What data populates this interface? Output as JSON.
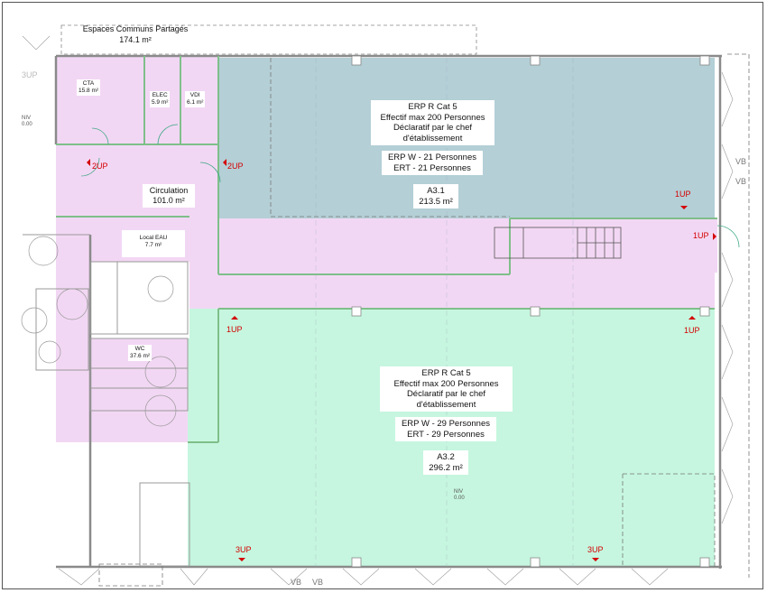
{
  "shared_space": {
    "name": "Espaces Communs Partagés",
    "area": "174.1 m²"
  },
  "rooms": {
    "cta": {
      "name": "CTA",
      "area": "15.8 m²"
    },
    "elec": {
      "name": "ELEC",
      "area": "5.9 m²"
    },
    "vdi": {
      "name": "VDI",
      "area": "6.1 m²"
    },
    "circulation": {
      "name": "Circulation",
      "area": "101.0 m²"
    },
    "local_eau": {
      "name": "Local EAU",
      "area": "7.7 m²"
    },
    "wc": {
      "name": "WC",
      "area": "37.6 m²"
    }
  },
  "a31": {
    "line1": "ERP R Cat 5",
    "line2": "Effectif max  200 Personnes",
    "line3": "Déclaratif par le chef",
    "line4": "d'établissement",
    "erp_w": "ERP W - 21 Personnes",
    "ert": "ERT - 21 Personnes",
    "id": "A3.1",
    "area": "213.5 m²"
  },
  "a32": {
    "line1": "ERP R Cat 5",
    "line2": "Effectif max  200 Personnes",
    "line3": "Déclaratif par le chef",
    "line4": "d'établissement",
    "erp_w": "ERP W - 29 Personnes",
    "ert": "ERT - 29 Personnes",
    "id": "A3.2",
    "area": "296.2 m²"
  },
  "markers": {
    "up3_top": "3UP",
    "up2_left": "2UP",
    "up2_mid": "2UP",
    "up1_right_top": "1UP",
    "up1_right_stairs": "1UP",
    "up1_left": "1UP",
    "up1_right": "1UP",
    "up3_bottom_left": "3UP",
    "up3_bottom_right": "3UP"
  },
  "levels": {
    "niv_left": "NIV",
    "niv_left_val": "0.00",
    "niv_center": "NIV",
    "niv_center_val": "0.00"
  },
  "vb_labels": {
    "vb1": "VB",
    "vb2": "VB",
    "vb3": "VB",
    "vb4": "VB"
  },
  "colors": {
    "circulation": "#f2d7f4",
    "a31": "#b4cfd6",
    "a32": "#c6f6df",
    "wall": "#8a8a8a",
    "green_line": "#7fbf8a",
    "up_marker": "#d40000"
  }
}
